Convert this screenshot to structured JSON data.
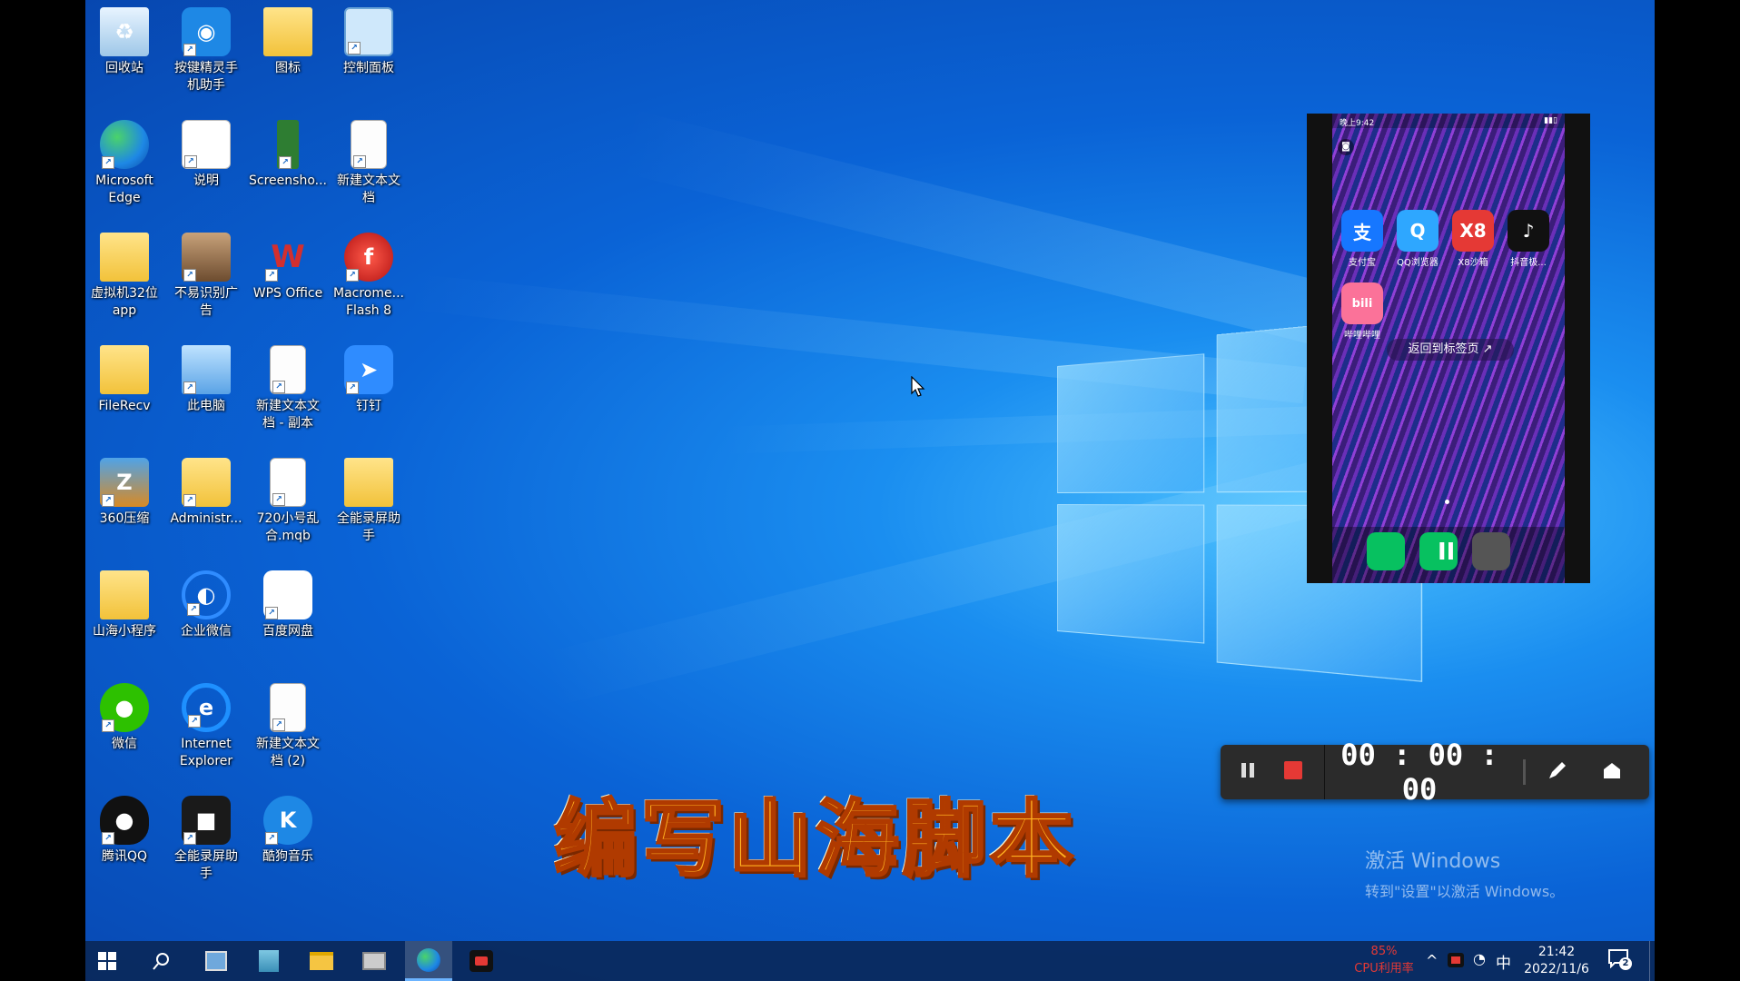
{
  "desktop_icons": [
    {
      "label": "回收站",
      "icon": "recycle-bin-icon"
    },
    {
      "label": "按键精灵手\n机助手",
      "icon": "robot-icon"
    },
    {
      "label": "图标",
      "icon": "folder-icon"
    },
    {
      "label": "控制面板",
      "icon": "control-panel-icon"
    },
    {
      "label": "Microsoft\nEdge",
      "icon": "edge-icon"
    },
    {
      "label": "说明",
      "icon": "word-doc-icon"
    },
    {
      "label": "Screensho...",
      "icon": "phone-screenshot-icon"
    },
    {
      "label": "新建文本文\n档",
      "icon": "text-file-icon"
    },
    {
      "label": "虚拟机32位\napp",
      "icon": "folder-icon"
    },
    {
      "label": "不易识别广\n告",
      "icon": "image-file-icon"
    },
    {
      "label": "WPS Office",
      "icon": "wps-icon"
    },
    {
      "label": "Macrome...\nFlash 8",
      "icon": "flash-icon"
    },
    {
      "label": "FileRecv",
      "icon": "folder-icon"
    },
    {
      "label": "此电脑",
      "icon": "computer-icon"
    },
    {
      "label": "新建文本文\n档 - 副本",
      "icon": "text-file-icon"
    },
    {
      "label": "钉钉",
      "icon": "dingtalk-icon"
    },
    {
      "label": "360压缩",
      "icon": "zip-icon"
    },
    {
      "label": "Administr...",
      "icon": "user-folder-icon"
    },
    {
      "label": "720小号乱\n合.mqb",
      "icon": "blank-file-icon"
    },
    {
      "label": "全能录屏助\n手",
      "icon": "folder-icon"
    },
    {
      "label": "山海小程序",
      "icon": "folder-icon"
    },
    {
      "label": "企业微信",
      "icon": "wecom-icon"
    },
    {
      "label": "百度网盘",
      "icon": "baidu-netdisk-icon"
    },
    {
      "label": "微信",
      "icon": "wechat-icon"
    },
    {
      "label": "Internet\nExplorer",
      "icon": "ie-icon"
    },
    {
      "label": "新建文本文\n档 (2)",
      "icon": "text-file-icon"
    },
    {
      "label": "腾讯QQ",
      "icon": "qq-icon"
    },
    {
      "label": "全能录屏助\n手",
      "icon": "screen-recorder-icon"
    },
    {
      "label": "酷狗音乐",
      "icon": "kugou-icon"
    }
  ],
  "phone": {
    "status_time": "晚上9:42",
    "apps": [
      {
        "label": "支付宝",
        "glyph": "支",
        "color": "#1677ff"
      },
      {
        "label": "QQ浏览器",
        "glyph": "Q",
        "color": "#2ea7ff"
      },
      {
        "label": "X8沙箱",
        "glyph": "X8",
        "color": "#e53935"
      },
      {
        "label": "抖音极...",
        "glyph": "♪",
        "color": "#111111"
      },
      {
        "label": "哔哩哔哩",
        "glyph": "bili",
        "color": "#fb7299"
      }
    ],
    "back_to_tab_label": "返回到标签页",
    "dock": [
      {
        "icon": "wechat-icon",
        "color": "#07c160"
      },
      {
        "icon": "phone-call-icon",
        "color": "#07c160"
      },
      {
        "icon": "camera-icon",
        "color": "#555555"
      }
    ]
  },
  "recorder": {
    "timer": "00 : 00 : 00"
  },
  "caption": "编写山海脚本",
  "activation": {
    "title": "激活 Windows",
    "subtitle": "转到\"设置\"以激活 Windows。"
  },
  "taskbar": {
    "cpu_percent": "85%",
    "cpu_label": "CPU利用率",
    "ime": "中",
    "time": "21:42",
    "date": "2022/11/6",
    "notification_count": "2"
  },
  "colors": {
    "accent": "#0a63d6",
    "recorder_stop": "#e53935",
    "cpu_text": "#e53935"
  }
}
